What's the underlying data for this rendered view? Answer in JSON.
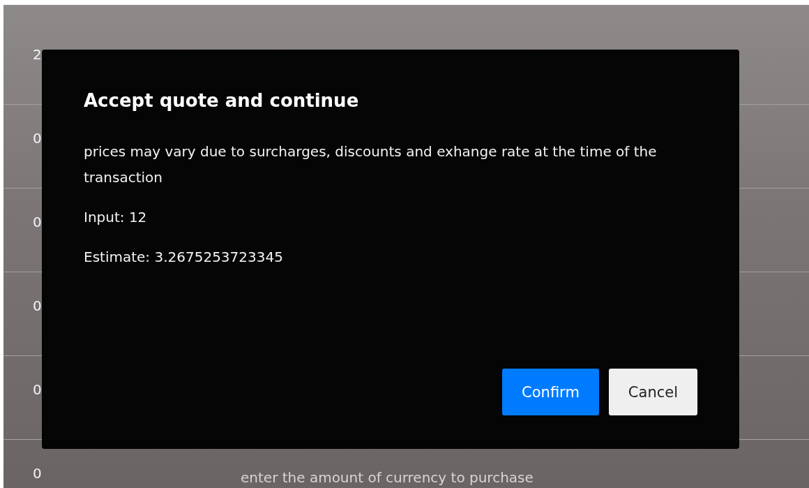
{
  "rows": [
    {
      "count": "2"
    },
    {
      "count": "0"
    },
    {
      "count": "0"
    },
    {
      "count": "0"
    },
    {
      "count": "0"
    },
    {
      "count": "0",
      "amount_placeholder": "enter the amount of currency to purchase"
    }
  ],
  "dialog": {
    "title": "Accept quote and continue",
    "message": "prices may vary due to surcharges, discounts and exhange rate at the time of the transaction",
    "input_line": "Input: 12",
    "estimate_line": "Estimate: 3.2675253723345",
    "buttons": [
      {
        "label": "Confirm",
        "kind": "primary"
      },
      {
        "label": "Cancel",
        "kind": "secondary"
      }
    ]
  }
}
